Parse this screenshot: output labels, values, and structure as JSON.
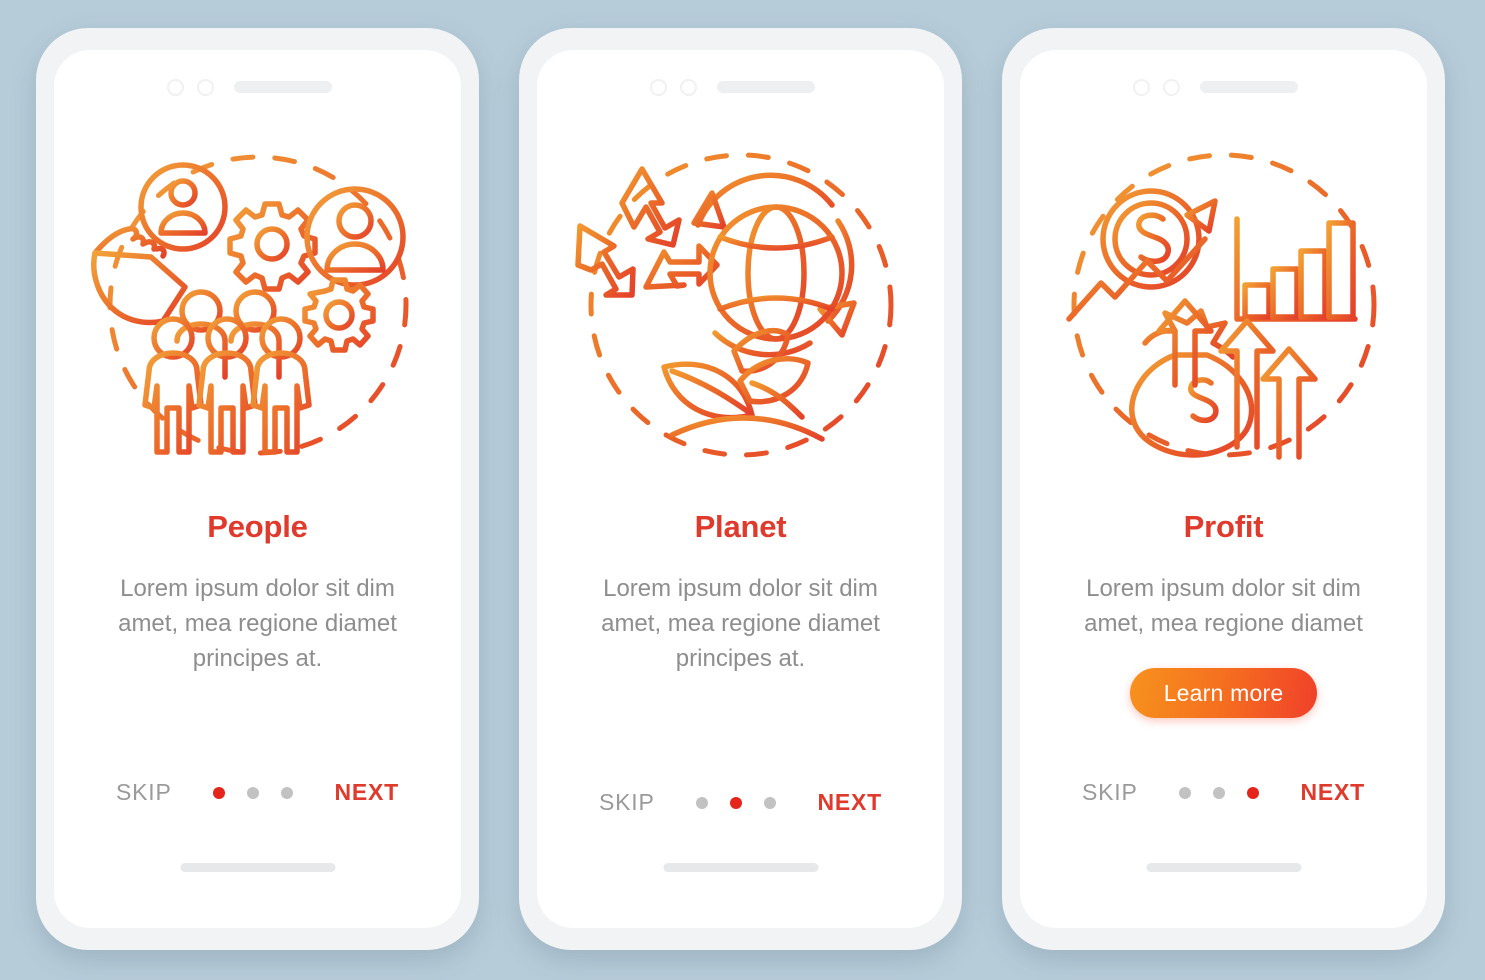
{
  "background_color": "#b7ccd9",
  "theme": {
    "title_color": "#e03a2c",
    "body_color": "#8e8e8e",
    "skip_color": "#9a9a9a",
    "next_color": "#e03a2c",
    "dot_active_color": "#e5241c",
    "dot_inactive_color": "#c2c2c2",
    "cta_gradient_from": "#f7921e",
    "cta_gradient_to": "#f0402a",
    "icon_gradient_from": "#f2962c",
    "icon_gradient_to": "#e4412a"
  },
  "screens": [
    {
      "id": "people",
      "title": "People",
      "body": "Lorem ipsum dolor sit dim amet, mea regione diamet principes at.",
      "illustration_name": "people-gears-illustration",
      "illustration_elements": [
        "pointing-hand-icon",
        "user-circle-icon",
        "gear-icon",
        "user-avatar-circle-icon",
        "crowd-group-icon",
        "dashed-circle-icon"
      ],
      "has_cta": false,
      "cta_label": "",
      "nav": {
        "skip_label": "SKIP",
        "next_label": "NEXT",
        "dot_count": 3,
        "active_dot": 0
      }
    },
    {
      "id": "planet",
      "title": "Planet",
      "body": "Lorem ipsum dolor sit dim amet, mea regione diamet principes at.",
      "illustration_name": "planet-recycle-illustration",
      "illustration_elements": [
        "recycle-icon",
        "globe-icon",
        "circular-arrows-icon",
        "leaves-plant-icon",
        "dashed-circle-icon"
      ],
      "has_cta": false,
      "cta_label": "",
      "nav": {
        "skip_label": "SKIP",
        "next_label": "NEXT",
        "dot_count": 3,
        "active_dot": 1
      }
    },
    {
      "id": "profit",
      "title": "Profit",
      "body": "Lorem ipsum dolor sit dim amet, mea regione diamet",
      "illustration_name": "profit-growth-illustration",
      "illustration_elements": [
        "dollar-coin-icon",
        "trend-arrow-icon",
        "bar-chart-icon",
        "money-bag-icon",
        "up-arrows-icon",
        "dashed-circle-icon"
      ],
      "has_cta": true,
      "cta_label": "Learn more",
      "nav": {
        "skip_label": "SKIP",
        "next_label": "NEXT",
        "dot_count": 3,
        "active_dot": 2
      }
    }
  ]
}
